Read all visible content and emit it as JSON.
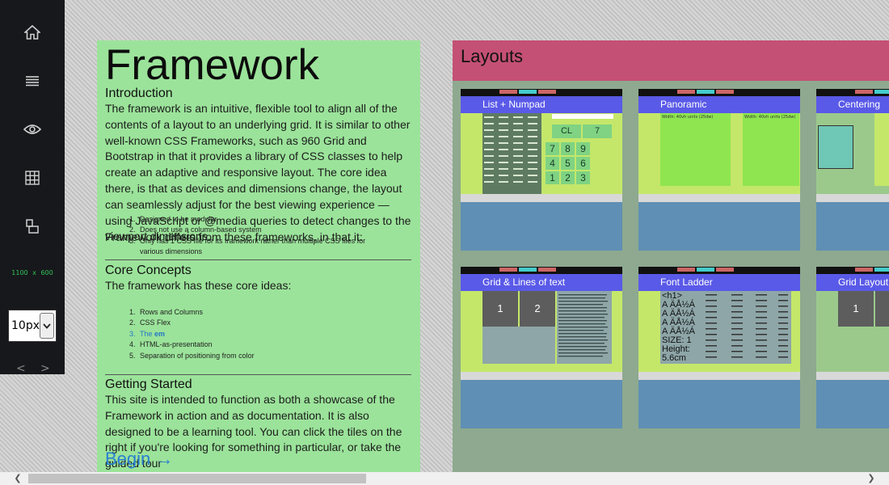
{
  "sidebar": {
    "dims_text": "1100 x 600",
    "font_size": "10px",
    "arrow_left": "<",
    "arrow_right": ">"
  },
  "left": {
    "title": "Framework",
    "intro_heading": "Introduction",
    "intro_text": "The framework is an intuitive, flexible tool to align all of the contents of a layout to an underlying grid. It is similar to other well-known CSS Frameworks, such as 960 Grid and Bootstrap in that it provides a library of CSS classes to help create an adaptive and responsive layout. The core idea there, is that as devices and dimensions change, the layout can seamlessly adjust for the best viewing experience — using JavaScript or @media queries to detect changes to the viewport dimensions.",
    "differs_text": "Framework differs from these frameworks, in that it:",
    "differs_items": [
      "Designed to be modular",
      "Does not use a column-based system",
      "Only has 1 CSS file for its framework rather than multiple CSS files for various dimensions"
    ],
    "core_heading": "Core Concepts",
    "core_text": "The framework has these core ideas:",
    "core_items": [
      "Rows and Columns",
      "CSS Flex",
      "The",
      "HTML-as-presentation",
      "Separation of positioning from color"
    ],
    "core_item3_em": "em",
    "gs_heading": "Getting Started",
    "gs_text": "This site is intended to function as both a showcase of the Framework in action and as documentation. It is also designed to be a learning tool. You can click the tiles on the right if you're looking for something in particular, or take the guided tour",
    "begin": "Begin →"
  },
  "right": {
    "heading": "Layouts",
    "tiles": [
      "List + Numpad",
      "Panoramic",
      "Centering",
      "Grid & Lines of text",
      "Font Ladder",
      "Grid Layout"
    ],
    "numpad_keys": [
      "CL",
      "7",
      "8",
      "9",
      "4",
      "5",
      "6",
      "1",
      "2",
      "3"
    ],
    "pano_label": "Width: 40vh units (25dw)",
    "grid_nums": [
      "1",
      "2",
      "1"
    ],
    "font_sample": "<h1>\nA ÄÅ½Á\nA ÄÅ½Á\nA ÄÅ½Á\nA ÄÅ½Á\nSIZE: 1\nHeight:\n5.6cm"
  },
  "colors": {
    "left_panel": "#9be39a",
    "right_header": "#c45076",
    "tile_title": "#5a5ae8",
    "tile_screen": "#c4e76a"
  }
}
